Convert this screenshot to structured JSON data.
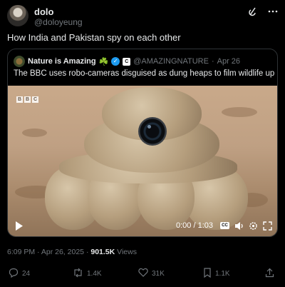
{
  "author": {
    "name": "dolo",
    "handle": "@doloyeung"
  },
  "header_icons": [
    "grok-icon",
    "more-icon"
  ],
  "tweet": {
    "text": "How India and Pakistan spy on each other"
  },
  "quoted": {
    "name": "Nature is Amazing",
    "emoji": "☘️",
    "affiliate_badge": "C",
    "handle": "@AMAZINGNATURE",
    "separator": "·",
    "date": "Apr 26",
    "text": "The BBC uses robo-cameras disguised as dung heaps to film wildlife up close.",
    "video": {
      "watermark": [
        "B",
        "B",
        "C"
      ],
      "time": "0:00 / 1:03",
      "cc_label": "CC",
      "progress": 0
    }
  },
  "meta": {
    "time": "6:09 PM",
    "dot": "·",
    "date": "Apr 26, 2025",
    "views_count": "901.5K",
    "views_label": "Views"
  },
  "actions": {
    "replies": "24",
    "reposts": "1.4K",
    "likes": "31K",
    "bookmarks": "1.1K"
  },
  "colors": {
    "background": "#000000",
    "text": "#e7e9ea",
    "muted": "#71767b",
    "border": "#2f3336",
    "verified": "#1d9bf0"
  }
}
